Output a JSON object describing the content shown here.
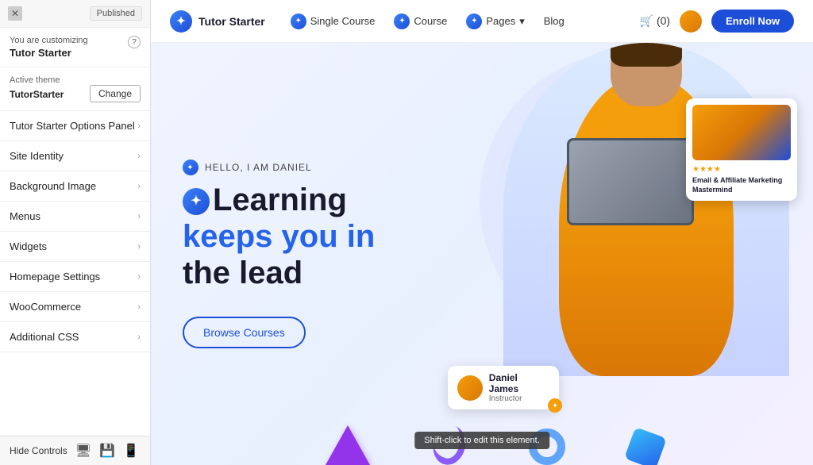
{
  "panel": {
    "close_label": "✕",
    "published_label": "Published",
    "customizing_text": "You are customizing",
    "customizing_title": "Tutor Starter",
    "help_icon": "?",
    "active_theme_label": "Active theme",
    "theme_name": "TutorStarter",
    "change_btn": "Change",
    "menu_items": [
      {
        "label": "Tutor Starter Options Panel"
      },
      {
        "label": "Site Identity"
      },
      {
        "label": "Background Image"
      },
      {
        "label": "Menus"
      },
      {
        "label": "Widgets"
      },
      {
        "label": "Homepage Settings"
      },
      {
        "label": "WooCommerce"
      },
      {
        "label": "Additional CSS"
      }
    ],
    "hide_controls": "Hide Controls"
  },
  "nav": {
    "logo_text": "Tutor Starter",
    "logo_icon": "✦",
    "links": [
      {
        "label": "Single Course",
        "icon": "✦"
      },
      {
        "label": "Course",
        "icon": "✦"
      },
      {
        "label": "Pages",
        "icon": "✦",
        "has_dropdown": true
      },
      {
        "label": "Blog"
      }
    ],
    "cart_label": "(0)",
    "enroll_btn": "Enroll Now"
  },
  "hero": {
    "subtitle": "HELLO, I AM DANIEL",
    "title_line1": "Learning",
    "title_line2": "keeps you in",
    "title_line3": "the lead",
    "browse_btn": "Browse Courses",
    "instructor_name": "Daniel James",
    "instructor_role": "Instructor",
    "course_stars": "★★★★",
    "course_title": "Email & Affiliate Marketing Mastermind",
    "tooltip": "Shift-click to edit this element."
  }
}
